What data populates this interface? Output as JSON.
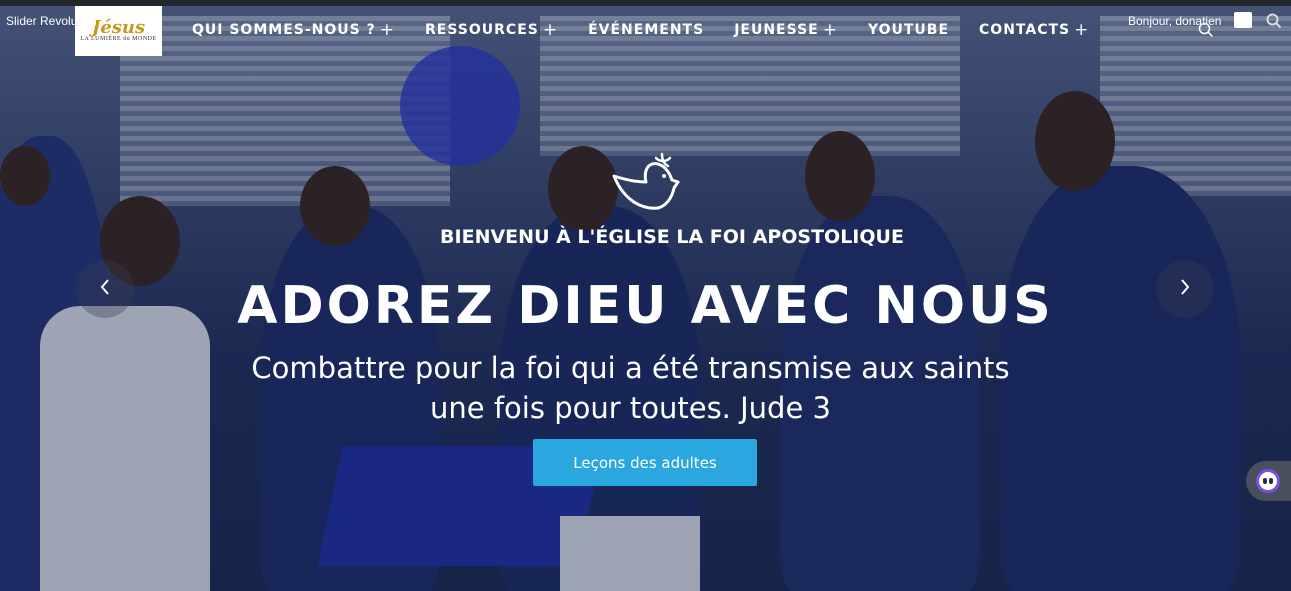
{
  "slider_label": "Slider Revolution",
  "logo": {
    "script_text": "Jésus",
    "subtitle": "LA LUMIÈRE du MONDE"
  },
  "nav": {
    "items": [
      {
        "label": "QUI SOMMES-NOUS ?",
        "has_submenu": true
      },
      {
        "label": "RESSOURCES",
        "has_submenu": true
      },
      {
        "label": "ÉVÉNEMENTS",
        "has_submenu": false
      },
      {
        "label": "JEUNESSE",
        "has_submenu": true
      },
      {
        "label": "YOUTUBE",
        "has_submenu": false
      },
      {
        "label": "CONTACTS",
        "has_submenu": true
      }
    ],
    "submenu_symbol": "+"
  },
  "user": {
    "greeting": "Bonjour, donatien"
  },
  "hero": {
    "kicker": "BIENVENU À L'ÉGLISE LA FOI APOSTOLIQUE",
    "headline": "ADOREZ DIEU AVEC NOUS",
    "subline_1": "Combattre pour la foi qui a été transmise aux saints",
    "subline_2": "une fois pour toutes. Jude 3",
    "cta_label": "Leçons des adultes"
  },
  "icons": {
    "search": "search-icon",
    "dove": "dove-icon",
    "prev": "chevron-left-icon",
    "next": "chevron-right-icon",
    "chat": "chatbot-icon"
  },
  "colors": {
    "cta": "#29a7de",
    "admin_bar": "#23282d",
    "chat_accent": "#7b4fe0",
    "logo_gold": "#c79a1f"
  }
}
